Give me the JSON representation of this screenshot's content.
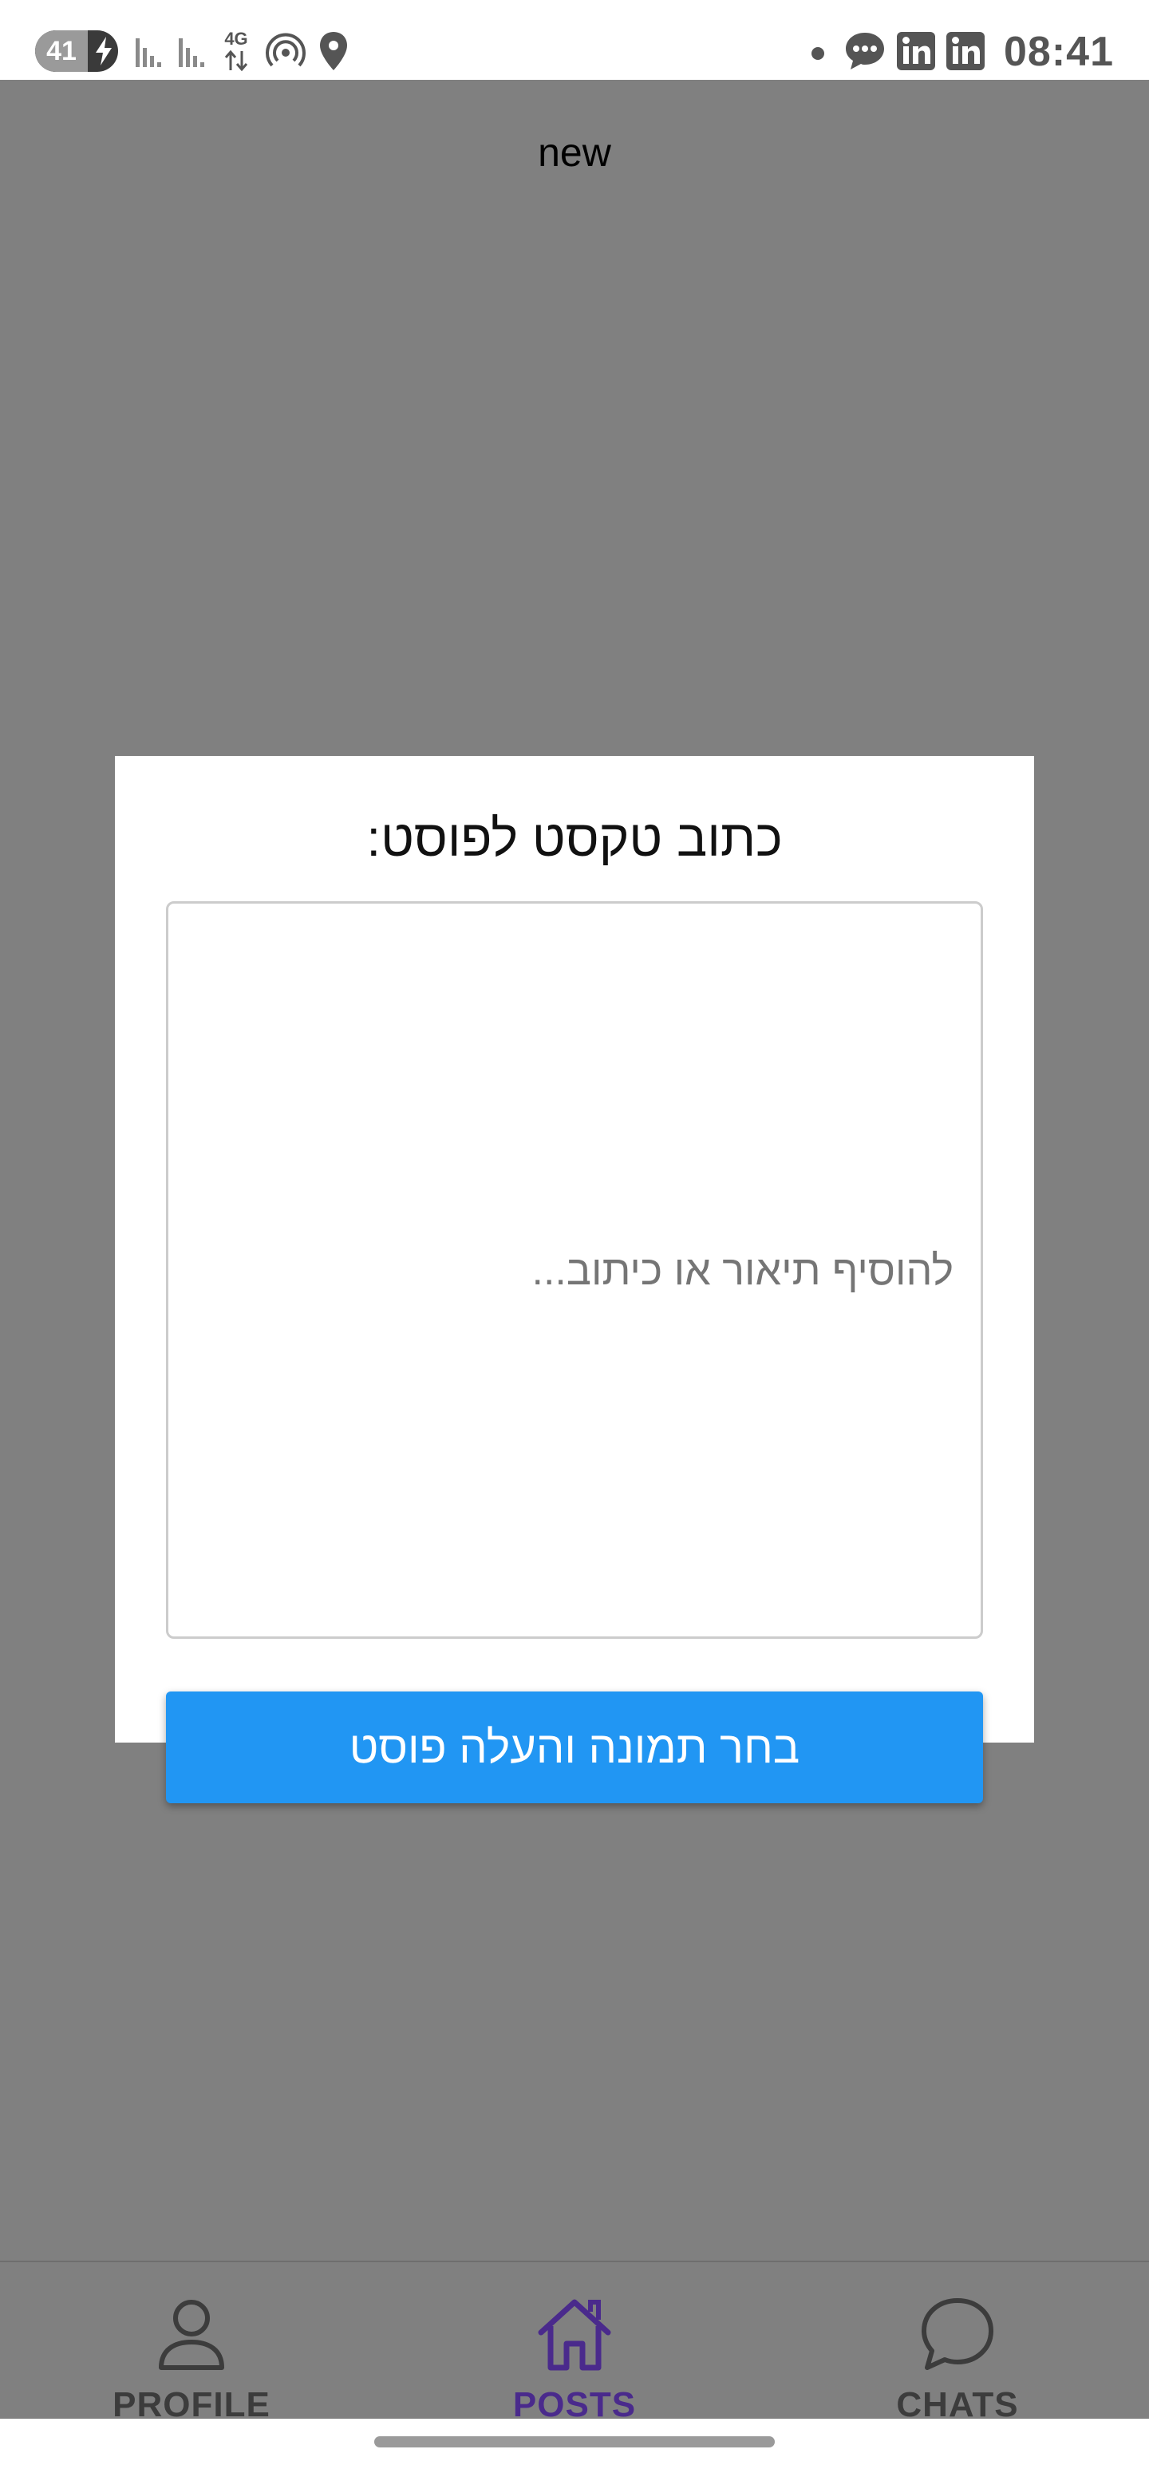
{
  "status_bar": {
    "battery_level": "41",
    "clock": "08:41",
    "network_label": "4G",
    "icons": [
      "charging-bolt-icon",
      "signal-icon",
      "signal-icon",
      "hotspot-icon",
      "location-icon",
      "dot-icon",
      "message-icon",
      "linkedin-icon",
      "linkedin-icon"
    ]
  },
  "app": {
    "title": "new"
  },
  "dialog": {
    "title": "כתוב טקסט לפוסט:",
    "textarea_placeholder": "להוסיף תיאור או כיתוב...",
    "submit_label": "בחר תמונה והעלה פוסט"
  },
  "bottom_nav": {
    "items": [
      {
        "label": "PROFILE",
        "icon": "person-icon",
        "active": false
      },
      {
        "label": "POSTS",
        "icon": "home-icon",
        "active": true
      },
      {
        "label": "CHATS",
        "icon": "chat-bubble-icon",
        "active": false
      }
    ]
  },
  "colors": {
    "scrim": "#808080",
    "primary_button": "#2196f3",
    "active_nav": "#4a2a8c"
  }
}
